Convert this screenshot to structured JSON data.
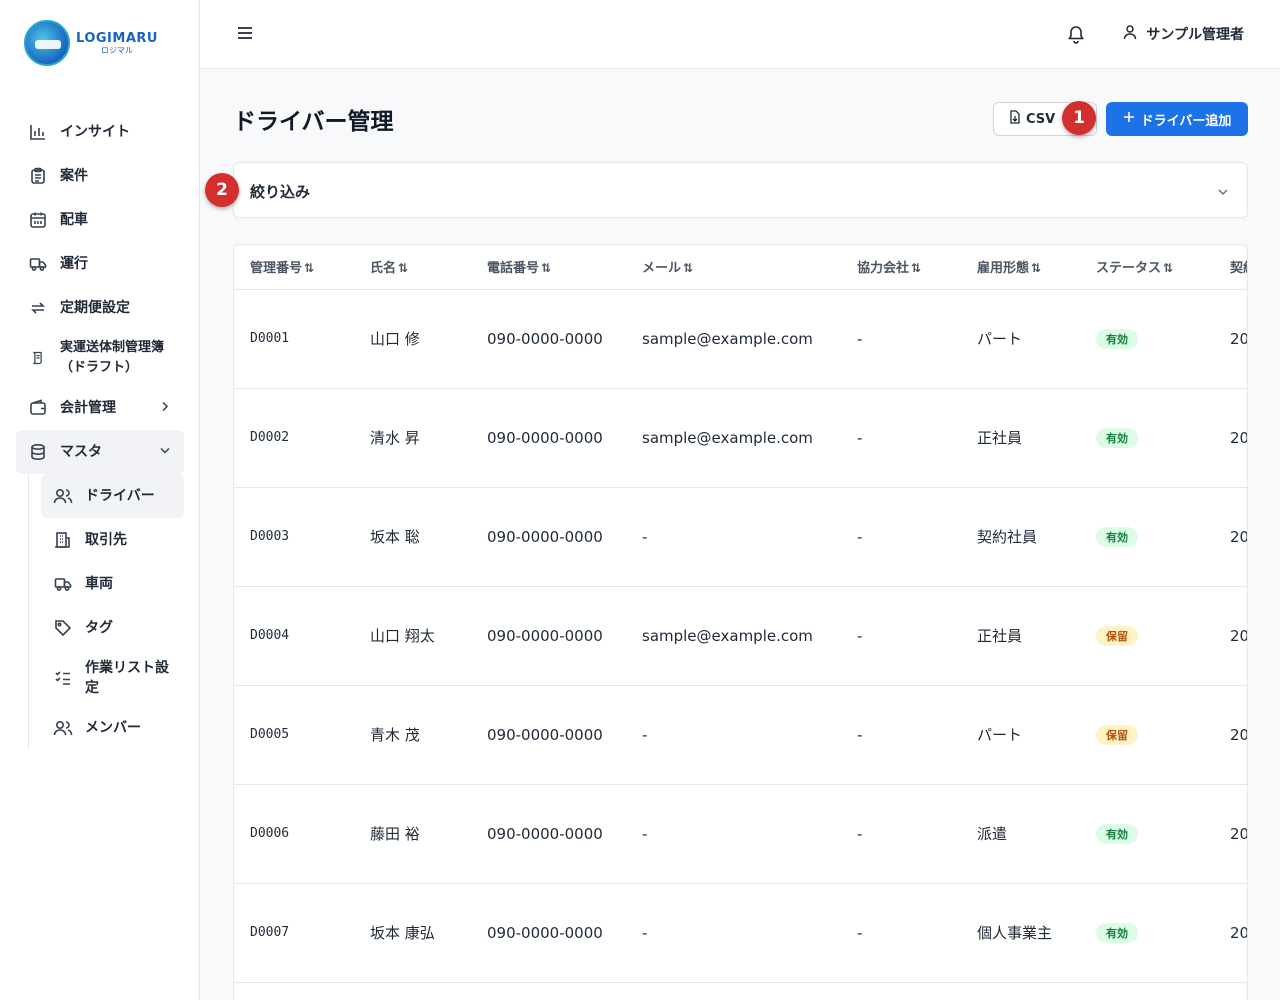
{
  "logo": {
    "main": "LOGIMARU",
    "sub": "ロジマル"
  },
  "header": {
    "user_name": "サンプル管理者"
  },
  "sidebar": {
    "items": [
      {
        "label": "インサイト",
        "icon": "bar-chart-icon"
      },
      {
        "label": "案件",
        "icon": "clipboard-icon"
      },
      {
        "label": "配車",
        "icon": "calendar-icon"
      },
      {
        "label": "運行",
        "icon": "truck-icon"
      },
      {
        "label": "定期便設定",
        "icon": "repeat-icon"
      },
      {
        "label": "実運送体制管理簿（ドラフト）",
        "icon": "scroll-icon"
      },
      {
        "label": "会計管理",
        "icon": "wallet-icon"
      },
      {
        "label": "マスタ",
        "icon": "database-icon"
      }
    ],
    "master_sub": [
      {
        "label": "ドライバー",
        "icon": "users-icon"
      },
      {
        "label": "取引先",
        "icon": "building-icon"
      },
      {
        "label": "車両",
        "icon": "truck-icon"
      },
      {
        "label": "タグ",
        "icon": "tag-icon"
      },
      {
        "label": "作業リスト設定",
        "icon": "checklist-icon"
      },
      {
        "label": "メンバー",
        "icon": "users-icon"
      }
    ]
  },
  "page": {
    "title": "ドライバー管理",
    "csv_label": "CSV",
    "add_label": "ドライバー追加",
    "filter_title": "絞り込み",
    "annotations": [
      "1",
      "2"
    ]
  },
  "table": {
    "columns": [
      "管理番号",
      "氏名",
      "電話番号",
      "メール",
      "協力会社",
      "雇用形態",
      "ステータス",
      "契約"
    ],
    "rows": [
      {
        "id": "D0001",
        "name": "山口 修",
        "phone": "090-0000-0000",
        "email": "sample@example.com",
        "partner": "-",
        "employment": "パート",
        "status": "有効",
        "status_type": "ok",
        "extra": "20"
      },
      {
        "id": "D0002",
        "name": "清水 昇",
        "phone": "090-0000-0000",
        "email": "sample@example.com",
        "partner": "-",
        "employment": "正社員",
        "status": "有効",
        "status_type": "ok",
        "extra": "20"
      },
      {
        "id": "D0003",
        "name": "坂本 聡",
        "phone": "090-0000-0000",
        "email": "-",
        "partner": "-",
        "employment": "契約社員",
        "status": "有効",
        "status_type": "ok",
        "extra": "20"
      },
      {
        "id": "D0004",
        "name": "山口 翔太",
        "phone": "090-0000-0000",
        "email": "sample@example.com",
        "partner": "-",
        "employment": "正社員",
        "status": "保留",
        "status_type": "hold",
        "extra": "20"
      },
      {
        "id": "D0005",
        "name": "青木 茂",
        "phone": "090-0000-0000",
        "email": "-",
        "partner": "-",
        "employment": "パート",
        "status": "保留",
        "status_type": "hold",
        "extra": "20"
      },
      {
        "id": "D0006",
        "name": "藤田 裕",
        "phone": "090-0000-0000",
        "email": "-",
        "partner": "-",
        "employment": "派遣",
        "status": "有効",
        "status_type": "ok",
        "extra": "20"
      },
      {
        "id": "D0007",
        "name": "坂本 康弘",
        "phone": "090-0000-0000",
        "email": "-",
        "partner": "-",
        "employment": "個人事業主",
        "status": "有効",
        "status_type": "ok",
        "extra": "20"
      }
    ]
  }
}
